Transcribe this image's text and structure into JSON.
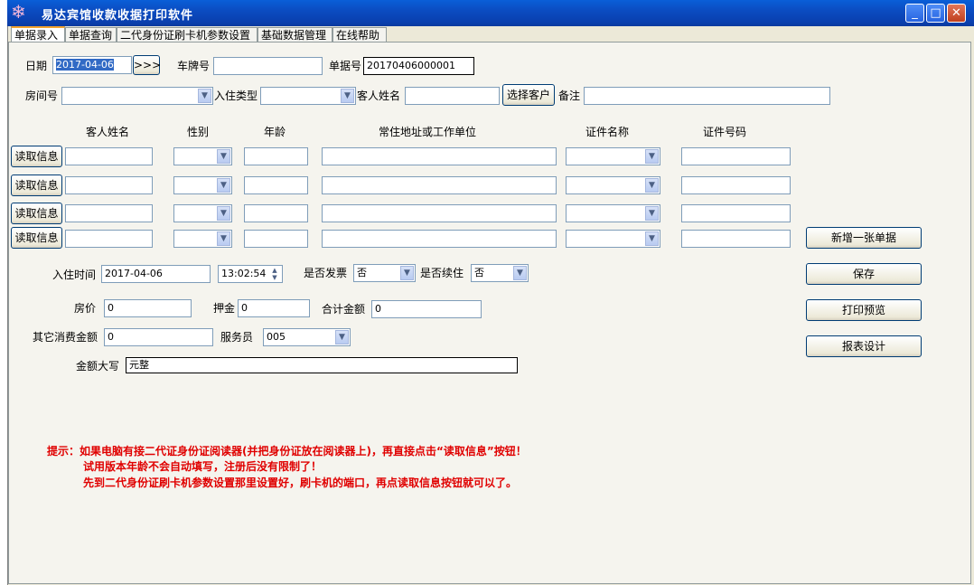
{
  "window": {
    "title": "易达宾馆收款收据打印软件",
    "app_icon": "snowflake-icon",
    "controls": [
      "minimize-icon",
      "maximize-icon",
      "close-icon"
    ]
  },
  "tabs": [
    {
      "label": "单据录入",
      "active": true
    },
    {
      "label": "单据查询",
      "active": false
    },
    {
      "label": "二代身份证刷卡机参数设置",
      "active": false
    },
    {
      "label": "基础数据管理",
      "active": false
    },
    {
      "label": "在线帮助",
      "active": false
    }
  ],
  "header": {
    "date_label": "日期",
    "date_value": "2017-04-06",
    "next_button": ">>>",
    "plate_label": "车牌号",
    "plate_value": "",
    "bill_label": "单据号",
    "bill_value": "20170406000001",
    "room_label": "房间号",
    "room_value": "",
    "checkin_type_label": "入住类型",
    "checkin_type_value": "",
    "guest_name_label": "客人姓名",
    "guest_name_value": "",
    "choose_guest_button": "选择客户",
    "remark_label": "备注",
    "remark_value": ""
  },
  "guest_table": {
    "columns": [
      "客人姓名",
      "性别",
      "年龄",
      "常住地址或工作单位",
      "证件名称",
      "证件号码"
    ],
    "read_button": "读取信息",
    "rows": [
      {
        "name": "",
        "gender": "",
        "age": "",
        "address": "",
        "id_type": "",
        "id_number": ""
      },
      {
        "name": "",
        "gender": "",
        "age": "",
        "address": "",
        "id_type": "",
        "id_number": ""
      },
      {
        "name": "",
        "gender": "",
        "age": "",
        "address": "",
        "id_type": "",
        "id_number": ""
      },
      {
        "name": "",
        "gender": "",
        "age": "",
        "address": "",
        "id_type": "",
        "id_number": ""
      }
    ]
  },
  "details": {
    "checkin_time_label": "入住时间",
    "checkin_date": "2017-04-06",
    "checkin_clock": "13:02:54",
    "invoice_label": "是否发票",
    "invoice_value": "否",
    "continue_label": "是否续住",
    "continue_value": "否",
    "room_price_label": "房价",
    "room_price_value": "0",
    "deposit_label": "押金",
    "deposit_value": "0",
    "total_label": "合计金额",
    "total_value": "0",
    "other_label": "其它消费金额",
    "other_value": "0",
    "staff_label": "服务员",
    "staff_value": "005",
    "amount_caps_label": "金额大写",
    "amount_caps_value": "元整"
  },
  "actions": {
    "new_bill": "新增一张单据",
    "save": "保存",
    "print_preview": "打印预览",
    "report_design": "报表设计"
  },
  "hints": {
    "line1": "提示：如果电脑有接二代证身份证阅读器(并把身份证放在阅读器上)，再直接点击“读取信息”按钮！",
    "line2": "试用版本年龄不会自动填写，注册后没有限制了！",
    "line3": "先到二代身份证刷卡机参数设置那里设置好，刷卡机的端口，再点读取信息按钮就可以了。"
  },
  "colors": {
    "titlebar": "#0b4cc1",
    "hint_text": "#e00000",
    "panel": "#f5f4ee"
  }
}
